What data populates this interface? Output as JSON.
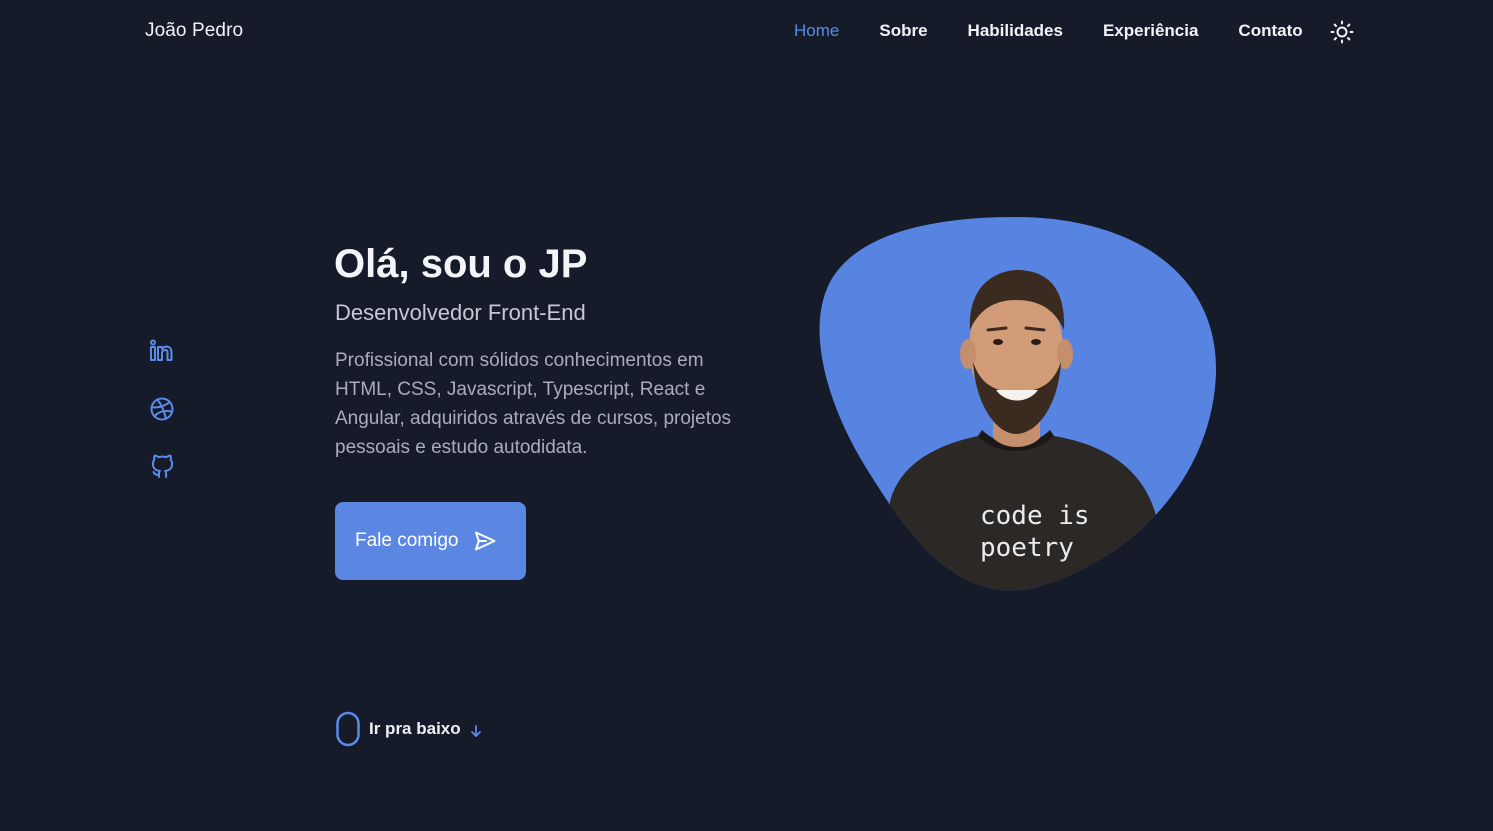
{
  "header": {
    "logo": "João Pedro",
    "nav": [
      {
        "label": "Home",
        "active": true
      },
      {
        "label": "Sobre",
        "active": false
      },
      {
        "label": "Habilidades",
        "active": false
      },
      {
        "label": "Experiência",
        "active": false
      },
      {
        "label": "Contato",
        "active": false
      }
    ],
    "theme_icon": "sun-icon"
  },
  "social": {
    "icons": [
      "linkedin-icon",
      "dribbble-icon",
      "github-icon"
    ],
    "color": "#5b8bea"
  },
  "hero": {
    "title": "Olá, sou o JP",
    "subtitle": "Desenvolvedor Front-End",
    "description": "Profissional com sólidos conhecimentos em HTML, CSS, Javascript, Typescript, React e Angular, adquiridos através de cursos, projetos pessoais e estudo autodidata.",
    "cta_label": "Fale comigo",
    "cta_icon": "send-icon",
    "accent": "#5b87e3"
  },
  "portrait": {
    "shirt_text_line1": "code is",
    "shirt_text_line2": "poetry"
  },
  "scroll": {
    "label": "Ir pra baixo",
    "icons": [
      "mouse-icon",
      "arrow-down-icon"
    ]
  },
  "colors": {
    "background": "#161b2a",
    "accent": "#5b8bea",
    "text": "#eef0f5"
  }
}
